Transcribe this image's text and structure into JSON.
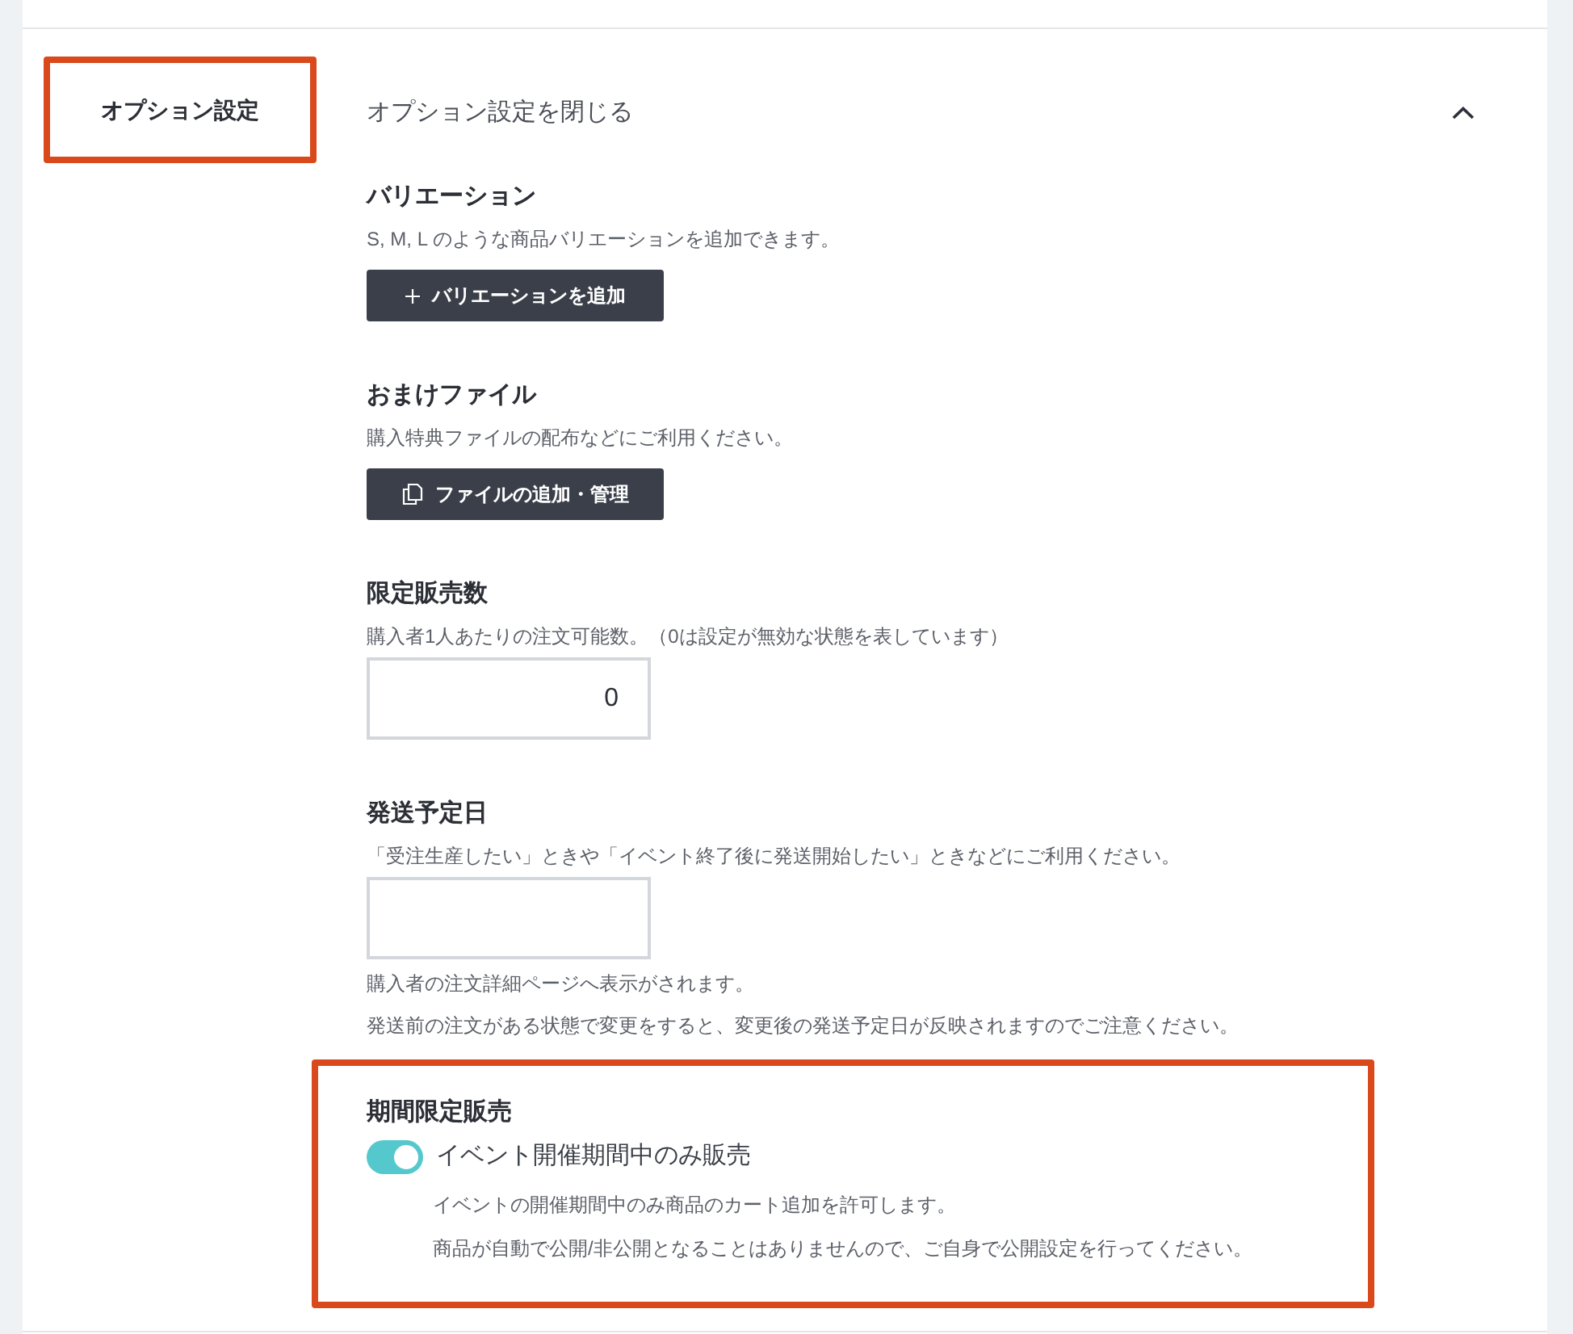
{
  "option_panel": {
    "label": "オプション設定",
    "highlighted": true,
    "collapse_link": "オプション設定を閉じる",
    "expanded": true
  },
  "sections": [
    {
      "kind": "button",
      "title": "バリエーション",
      "description": "S, M, L のような商品バリエーションを追加できます。",
      "button": {
        "kind": "add",
        "label": "バリエーションを追加"
      },
      "highlighted": false
    },
    {
      "kind": "button",
      "title": "おまけファイル",
      "description": "購入特典ファイルの配布などにご利用ください。",
      "button": {
        "kind": "files",
        "label": "ファイルの追加・管理"
      },
      "highlighted": false
    },
    {
      "kind": "input",
      "title": "限定販売数",
      "description": "購入者1人あたりの注文可能数。（0は設定が無効な状態を表しています）",
      "input": {
        "kind": "number",
        "value": "0"
      },
      "highlighted": false
    },
    {
      "kind": "input",
      "title": "発送予定日",
      "description": "「受注生産したい」ときや「イベント終了後に発送開始したい」ときなどにご利用ください。",
      "input": {
        "kind": "date"
      },
      "notes": [
        "購入者の注文詳細ページへ表示がされます。",
        "発送前の注文がある状態で変更をすると、変更後の発送予定日が反映されますのでご注意ください。"
      ],
      "highlighted": false
    },
    {
      "kind": "toggle",
      "title": "期間限定販売",
      "toggle": {
        "label": "イベント開催期間中のみ販売",
        "on": true
      },
      "notes": [
        "イベントの開催期間中のみ商品のカート追加を許可します。",
        "商品が自動で公開/非公開となることはありませんので、ご自身で公開設定を行ってください。"
      ],
      "highlighted": true
    }
  ]
}
